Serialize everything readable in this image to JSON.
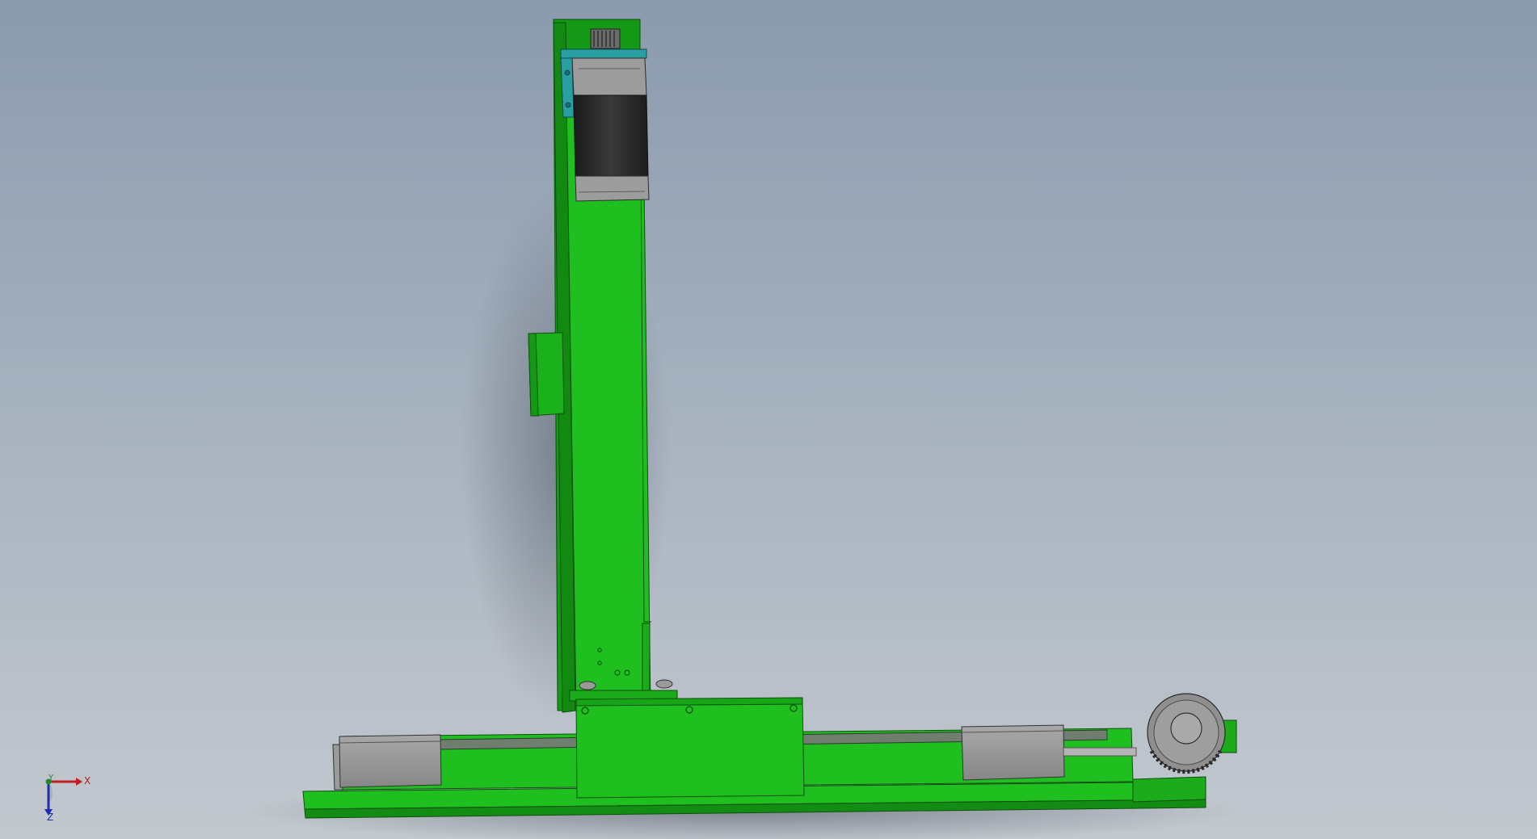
{
  "viewport": {
    "background_top": "#8b9aae",
    "background_bottom": "#c3c8cf"
  },
  "model": {
    "frame_color": "#1fbf1f",
    "frame_dark": "#149a14",
    "motor_body_color": "#2a2a2a",
    "motor_cap_color": "#9c9c9c",
    "motor_mount_color": "#2a9fa3",
    "block_color": "#9a9a9a"
  },
  "triad": {
    "x_label": "X",
    "y_label": "Y",
    "z_label": "Z",
    "x_color": "#c01f1f",
    "y_color": "#1d8a2d",
    "z_color": "#1d2fae"
  }
}
